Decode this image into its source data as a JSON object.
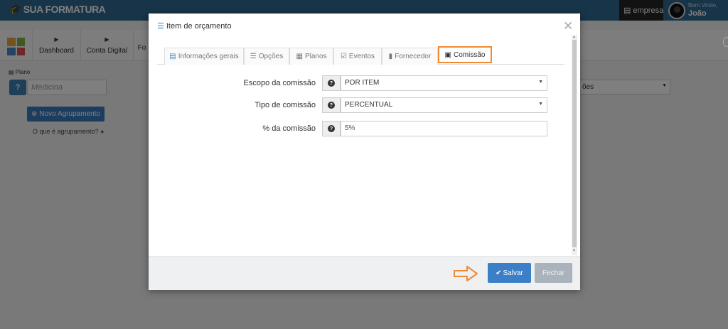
{
  "header": {
    "brand": "SUA FORMATURA",
    "company": "empresa",
    "welcome": "Bem Vindo,",
    "user_name": "João"
  },
  "nav": {
    "items": [
      {
        "label": "Dashboard"
      },
      {
        "label": "Conta Digital"
      },
      {
        "label": "Fo"
      }
    ]
  },
  "left_panel": {
    "plan_label": "Plano",
    "plan_value": "Medicina",
    "new_group_label": "Novo Agrupamento",
    "group_help": "O que é agrupamento?"
  },
  "background_select": {
    "value": "ões"
  },
  "modal": {
    "title": "Item de orçamento",
    "tabs": [
      {
        "label": "Informações gerais",
        "icon": "document-icon",
        "active": false
      },
      {
        "label": "Opções",
        "icon": "list-icon",
        "active": false
      },
      {
        "label": "Planos",
        "icon": "calculator-icon",
        "active": false
      },
      {
        "label": "Eventos",
        "icon": "calendar-check-icon",
        "active": false
      },
      {
        "label": "Fornecedor",
        "icon": "building-icon",
        "active": false
      },
      {
        "label": "Comissão",
        "icon": "money-icon",
        "active": true
      }
    ],
    "fields": {
      "commission_scope": {
        "label": "Escopo da comissão",
        "value": "POR ITEM"
      },
      "commission_type": {
        "label": "Tipo de comissão",
        "value": "PERCENTUAL"
      },
      "commission_percent": {
        "label": "% da comissão",
        "value": "5%"
      }
    },
    "save_label": "Salvar",
    "close_label": "Fechar"
  },
  "colors": {
    "topbar": "#2f6891",
    "primary_button": "#3a7fc8",
    "highlight": "#f08a34",
    "disabled_button": "#aab2bb"
  }
}
